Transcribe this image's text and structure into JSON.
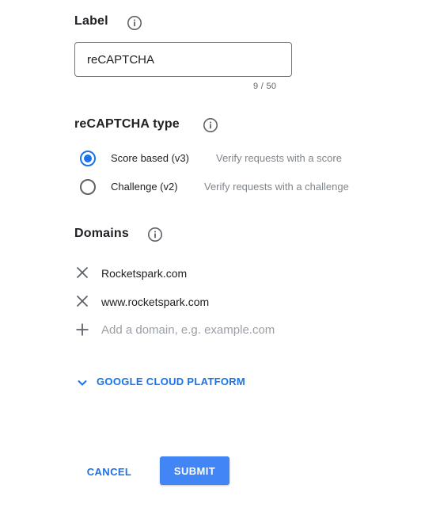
{
  "label_section": {
    "title": "Label",
    "info_icon": "info-icon",
    "input_value": "reCAPTCHA",
    "char_count": "9 / 50"
  },
  "type_section": {
    "title": "reCAPTCHA type",
    "info_icon": "info-icon",
    "options": [
      {
        "label": "Score based (v3)",
        "description": "Verify requests with a score",
        "selected": true
      },
      {
        "label": "Challenge (v2)",
        "description": "Verify requests with a challenge",
        "selected": false
      }
    ]
  },
  "domains_section": {
    "title": "Domains",
    "info_icon": "info-icon",
    "remove_icon": "close-icon",
    "add_icon": "plus-icon",
    "domains": [
      "Rocketspark.com",
      "www.rocketspark.com"
    ],
    "add_placeholder": "Add a domain, e.g. example.com"
  },
  "gcp_section": {
    "label": "GOOGLE CLOUD PLATFORM",
    "icon": "chevron-down-icon"
  },
  "actions": {
    "cancel_label": "CANCEL",
    "submit_label": "SUBMIT"
  },
  "colors": {
    "accent": "#1a73e8",
    "submit_bg": "#4285f4",
    "text": "#202124",
    "muted": "#80868b"
  }
}
